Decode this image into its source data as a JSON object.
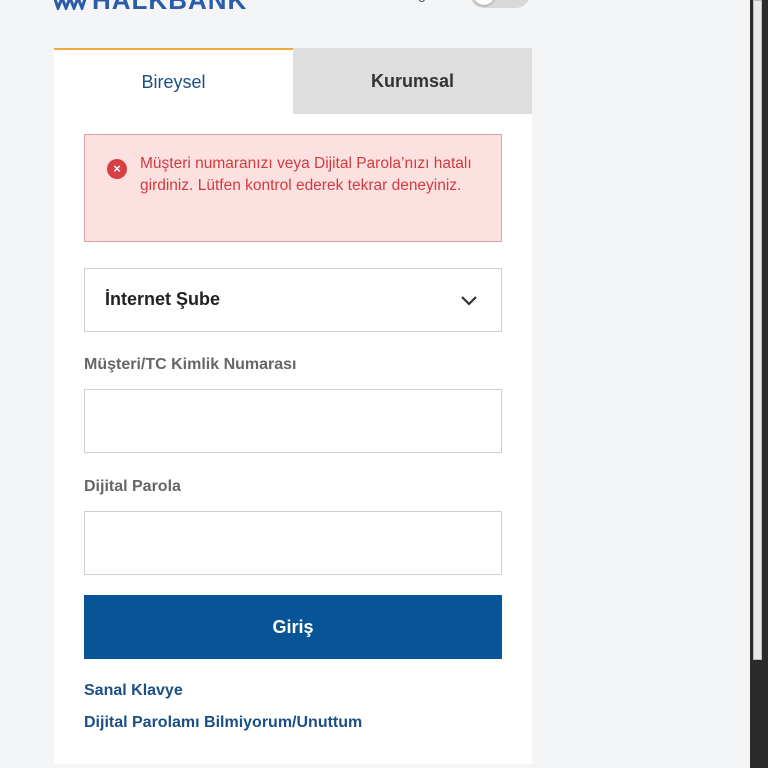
{
  "header": {
    "logo_text": "HALKBANK",
    "lang_text": "g"
  },
  "tabs": [
    {
      "label": "Bireysel",
      "active": true
    },
    {
      "label": "Kurumsal",
      "active": false
    }
  ],
  "alert": {
    "icon": "error-x-icon",
    "message": "Müşteri numaranızı veya Dijital Parola’nızı hatalı girdiniz. Lütfen kontrol ederek tekrar deneyiniz."
  },
  "channel_select": {
    "value": "İnternet Şube"
  },
  "customer_field": {
    "label": "Müşteri/TC Kimlik Numarası",
    "value": ""
  },
  "password_field": {
    "label": "Dijital Parola",
    "value": ""
  },
  "login_button": {
    "label": "Giriş"
  },
  "links": {
    "virtual_keyboard": "Sanal Klavye",
    "forgot_password": "Dijital Parolamı Bilmiyorum/Unuttum"
  },
  "colors": {
    "brand_blue": "#075596",
    "tab_accent": "#f0a83a",
    "error_red": "#d33a3e",
    "error_bg": "#fde1e1"
  }
}
